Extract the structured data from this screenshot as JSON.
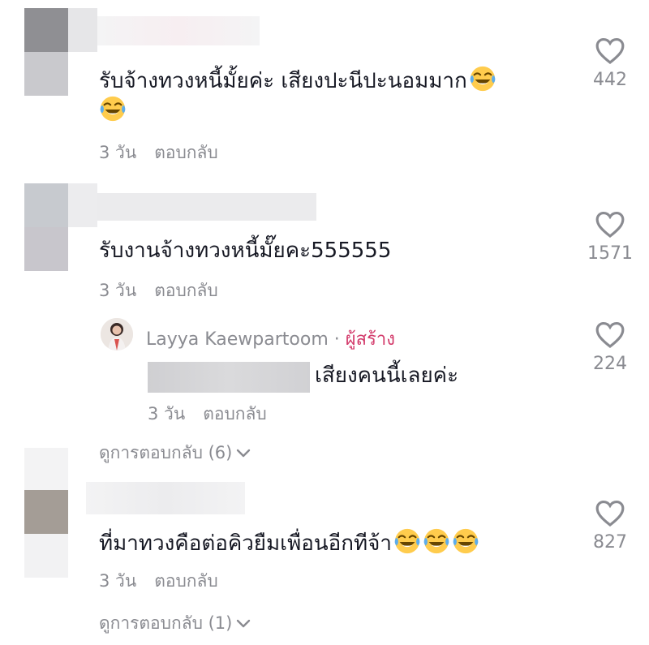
{
  "comments": [
    {
      "text": "รับจ้างทวงหนี้มั้ยค่ะ เสียงปะนีปะนอมมาก",
      "time": "3 วัน",
      "reply_label": "ตอบกลับ",
      "likes": "442"
    },
    {
      "text": "รับงานจ้างทวงหนี้มั๊ยคะ555555",
      "time": "3 วัน",
      "reply_label": "ตอบกลับ",
      "likes": "1571",
      "reply": {
        "author": "Layya Kaewpartoom",
        "separator": "·",
        "badge": "ผู้สร้าง",
        "text": "เสียงคนนี้เลยค่ะ",
        "time": "3 วัน",
        "reply_label": "ตอบกลับ",
        "likes": "224"
      },
      "view_replies": "ดูการตอบกลับ (6)"
    },
    {
      "text": "ที่มาทวงคือต่อคิวยืมเพื่อนอีกทีจ้า",
      "time": "3 วัน",
      "reply_label": "ตอบกลับ",
      "likes": "827",
      "view_replies": "ดูการตอบกลับ (1)"
    }
  ],
  "icons": {
    "like": "heart-icon",
    "expand": "chevron-down-icon",
    "emoji": "face-with-tears-of-joy-emoji"
  },
  "colors": {
    "text": "#161823",
    "muted": "#8a8b91",
    "creator": "#d33b6b"
  }
}
